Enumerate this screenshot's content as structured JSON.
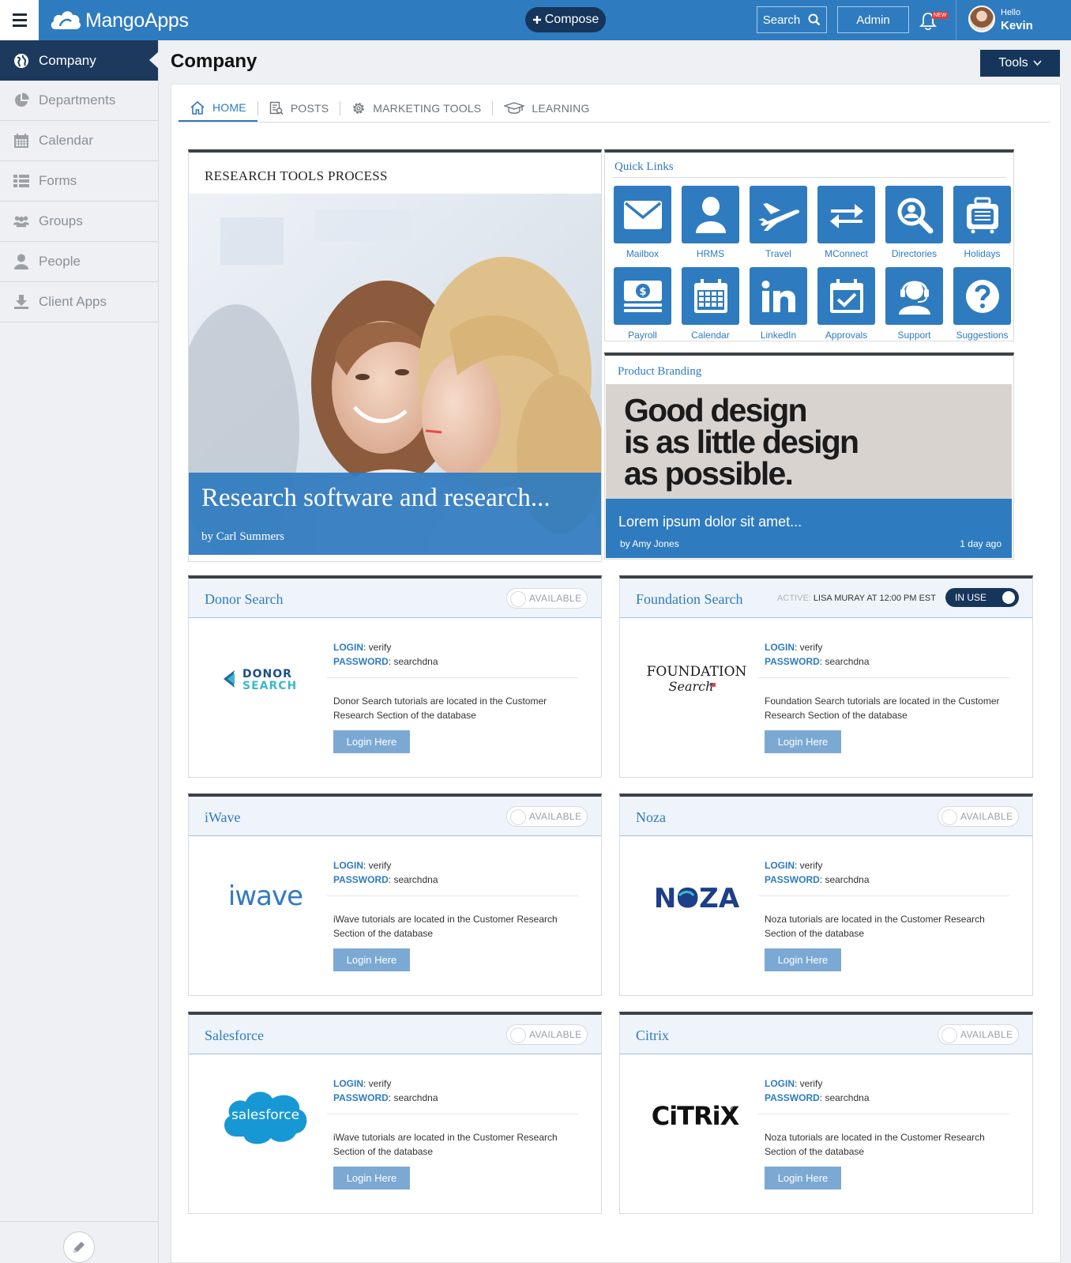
{
  "topbar": {
    "brand": "MangoApps",
    "compose_label": "Compose",
    "search_label": "Search",
    "admin_label": "Admin",
    "new_badge": "NEW",
    "greeting": "Hello",
    "user_name": "Kevin"
  },
  "sidebar": {
    "items": [
      {
        "label": "Company",
        "icon": "globe-icon",
        "active": true
      },
      {
        "label": "Departments",
        "icon": "pie-chart-icon"
      },
      {
        "label": "Calendar",
        "icon": "calendar-icon"
      },
      {
        "label": "Forms",
        "icon": "list-icon"
      },
      {
        "label": "Groups",
        "icon": "group-icon"
      },
      {
        "label": "People",
        "icon": "person-icon"
      },
      {
        "label": "Client Apps",
        "icon": "download-icon"
      }
    ]
  },
  "page": {
    "title": "Company",
    "tools_label": "Tools"
  },
  "tabs": [
    {
      "label": "HOME",
      "icon": "home-icon",
      "active": true
    },
    {
      "label": "POSTS",
      "icon": "posts-icon"
    },
    {
      "label": "MARKETING TOOLS",
      "icon": "gear-icon"
    },
    {
      "label": "LEARNING",
      "icon": "graduation-cap-icon"
    }
  ],
  "research": {
    "title": "RESEARCH TOOLS PROCESS",
    "headline": "Research software and research...",
    "byline": "by Carl Summers"
  },
  "quick_links": {
    "title": "Quick Links",
    "items": [
      {
        "label": "Mailbox",
        "icon": "mail-icon"
      },
      {
        "label": "HRMS",
        "icon": "person-icon"
      },
      {
        "label": "Travel",
        "icon": "airplane-icon"
      },
      {
        "label": "MConnect",
        "icon": "arrows-icon"
      },
      {
        "label": "Directories",
        "icon": "search-person-icon"
      },
      {
        "label": "Holidays",
        "icon": "luggage-icon"
      },
      {
        "label": "Payroll",
        "icon": "money-icon"
      },
      {
        "label": "Calendar",
        "icon": "calendar-icon"
      },
      {
        "label": "LinkedIn",
        "icon": "linkedin-icon"
      },
      {
        "label": "Approvals",
        "icon": "check-calendar-icon"
      },
      {
        "label": "Support",
        "icon": "headset-icon"
      },
      {
        "label": "Suggestions",
        "icon": "question-icon"
      }
    ]
  },
  "branding": {
    "title": "Product Branding",
    "quote_line1": "Good design",
    "quote_line2": "is as little design",
    "quote_line3": "as possible.",
    "headline": "Lorem ipsum dolor sit amet...",
    "byline": "by Amy Jones",
    "time": "1 day ago"
  },
  "vendor_common": {
    "login_key": "LOGIN",
    "login_value": "verify",
    "password_key": "PASSWORD",
    "password_value": "searchdna",
    "login_button": "Login Here",
    "available_label": "AVAILABLE"
  },
  "vendors": [
    {
      "name": "Donor Search",
      "status": "available",
      "logo_line1": "DONOR",
      "logo_line2": "SEARCH",
      "desc": "Donor Search tutorials are located in the Customer Research Section of the database"
    },
    {
      "name": "Foundation Search",
      "status": "in-use",
      "active_label": "ACTIVE:",
      "active_text": "LISA MURAY AT 12:00 PM EST",
      "inuse_label": "IN USE",
      "logo_line1": "FOUNDATION",
      "logo_line2": "Search",
      "desc": "Foundation Search tutorials are located in the Customer Research Section of the database"
    },
    {
      "name": "iWave",
      "status": "available",
      "logo_line1": "iwave",
      "desc": "iWave tutorials are located in the Customer Research Section of the database"
    },
    {
      "name": "Noza",
      "status": "available",
      "logo_line1": "NOZA",
      "desc": "Noza tutorials are located in the Customer Research Section of the database"
    },
    {
      "name": "Salesforce",
      "status": "available",
      "logo_line1": "salesforce",
      "desc": "iWave tutorials are located in the Customer Research Section of the database"
    },
    {
      "name": "Citrix",
      "status": "available",
      "logo_line1": "CiTRiX",
      "desc": "Noza tutorials are located in the Customer Research Section of the database"
    }
  ],
  "colors": {
    "brand_blue": "#2f7bbf",
    "navy": "#16355a",
    "sidebar_active": "#1d3a5e"
  }
}
